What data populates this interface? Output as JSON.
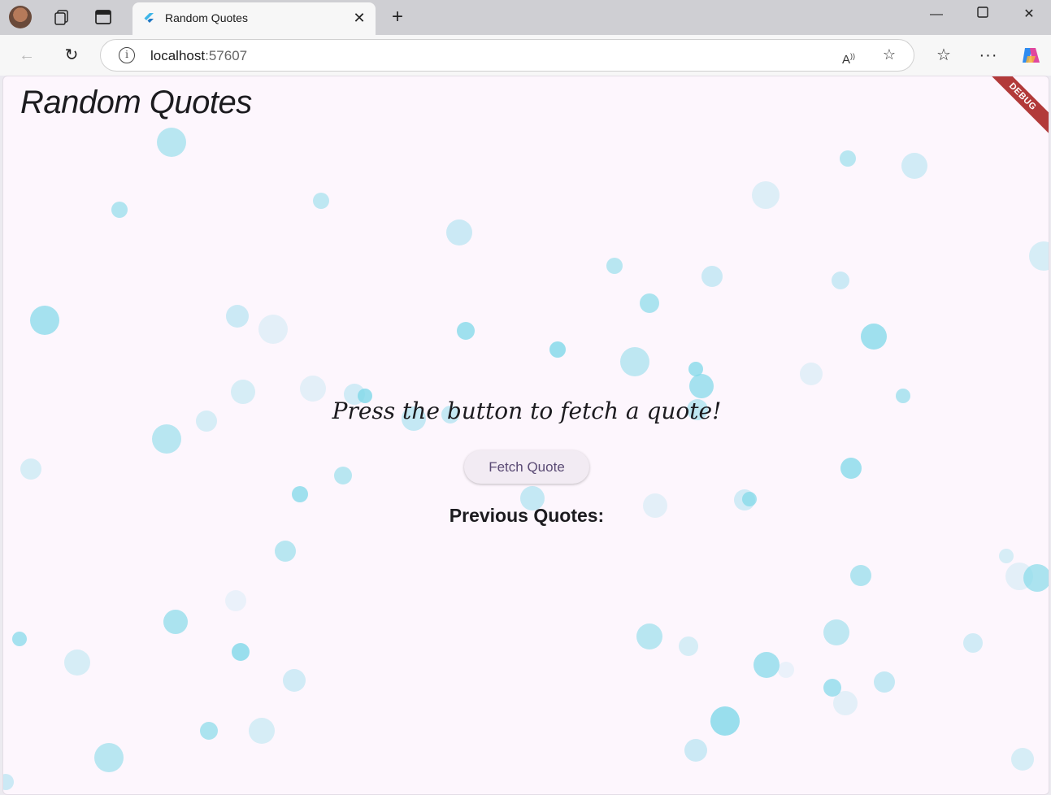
{
  "browser": {
    "tab_title": "Random Quotes",
    "address": "localhost",
    "port": ":57607",
    "icons": [
      "avatar-icon",
      "workspaces-icon",
      "tab-actions-icon",
      "flutter-favicon",
      "close-icon",
      "plus-icon",
      "minimize-icon",
      "maximize-icon",
      "close-window-icon",
      "back-icon",
      "refresh-icon",
      "info-icon",
      "read-aloud-icon",
      "favorite-star-icon",
      "favorites-icon",
      "more-icon",
      "copilot-icon"
    ]
  },
  "app": {
    "title": "Random Quotes",
    "debug_banner": "DEBUG",
    "prompt": "Press the button to fetch a quote!",
    "fetch_button": "Fetch Quote",
    "previous_heading": "Previous Quotes:"
  },
  "colors": {
    "app_background": "#fdf6fd",
    "bubble_cyan": "#7fd8e8",
    "debug_red": "#b23a3a"
  }
}
